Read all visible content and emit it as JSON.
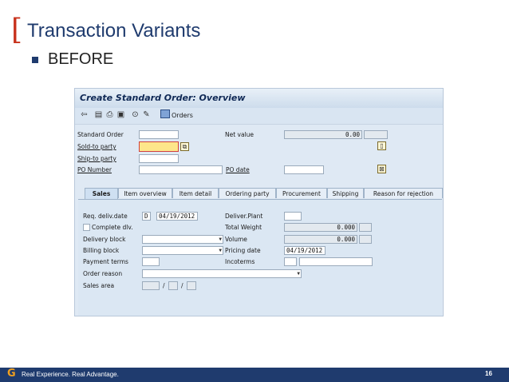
{
  "slide": {
    "title": "Transaction Variants",
    "bullet": "BEFORE",
    "footer_tagline": "Real Experience. Real Advantage.",
    "page_number": "16",
    "logo_letter": "G"
  },
  "sap": {
    "window_title": "Create Standard Order: Overview",
    "toolbar": {
      "orders_label": "Orders"
    },
    "header": {
      "standard_order_label": "Standard Order",
      "standard_order_value": "",
      "net_value_label": "Net value",
      "net_value_value": "0.00",
      "sold_to_label": "Sold-to party",
      "sold_to_value": "",
      "ship_to_label": "Ship-to party",
      "ship_to_value": "",
      "po_number_label": "PO Number",
      "po_number_value": "",
      "po_date_label": "PO date",
      "po_date_value": ""
    },
    "tabs": [
      "Sales",
      "Item overview",
      "Item detail",
      "Ordering party",
      "Procurement",
      "Shipping",
      "Reason for rejection"
    ],
    "sales": {
      "req_deliv_date_label": "Req. deliv.date",
      "req_deliv_date_type": "D",
      "req_deliv_date_value": "04/19/2012",
      "deliver_plant_label": "Deliver.Plant",
      "deliver_plant_value": "",
      "complete_dlv_label": "Complete dlv.",
      "total_weight_label": "Total Weight",
      "total_weight_value": "0.000",
      "delivery_block_label": "Delivery block",
      "volume_label": "Volume",
      "volume_value": "0.000",
      "billing_block_label": "Billing block",
      "pricing_date_label": "Pricing date",
      "pricing_date_value": "04/19/2012",
      "payment_terms_label": "Payment terms",
      "incoterms_label": "Incoterms",
      "order_reason_label": "Order reason",
      "sales_area_label": "Sales area",
      "sales_area_sep": "/"
    }
  }
}
